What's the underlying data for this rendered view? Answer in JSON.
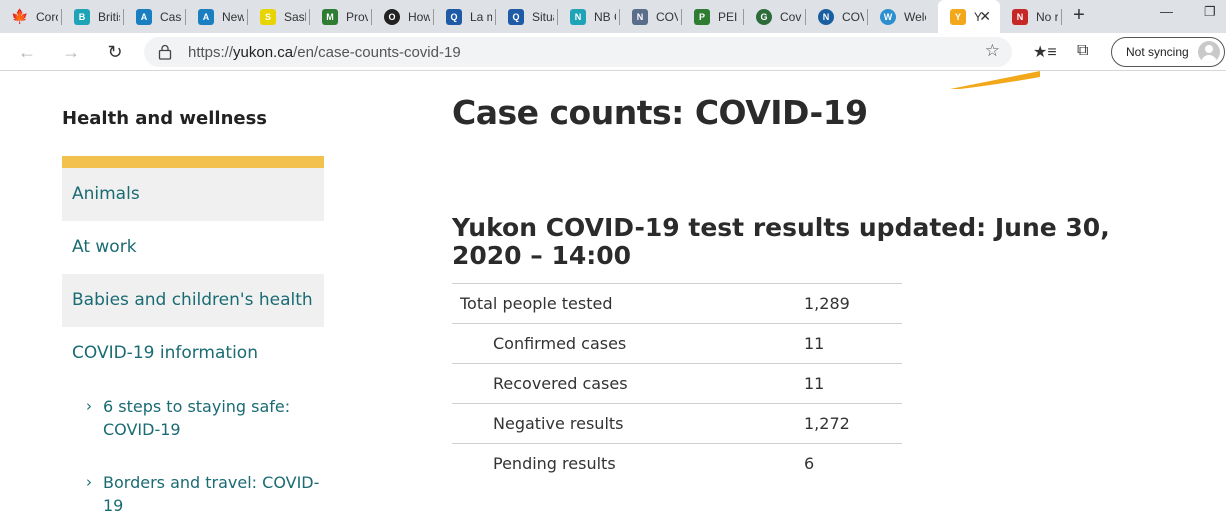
{
  "browser": {
    "tabs": [
      {
        "label": "Coro",
        "icon": "maple-leaf-icon",
        "color": "#d52b1e"
      },
      {
        "label": "Britis",
        "icon": "bc-gov-icon",
        "color": "#1fa3b7"
      },
      {
        "label": "Case",
        "icon": "alberta-icon",
        "color": "#1a7fc1"
      },
      {
        "label": "New",
        "icon": "alberta-icon",
        "color": "#1a7fc1"
      },
      {
        "label": "Sask",
        "icon": "saskatchewan-icon",
        "color": "#d6c400"
      },
      {
        "label": "Prov",
        "icon": "manitoba-icon",
        "color": "#2e7d32"
      },
      {
        "label": "How",
        "icon": "ontario-icon",
        "color": "#222222"
      },
      {
        "label": "La m",
        "icon": "quebec-icon",
        "color": "#1f5aa6"
      },
      {
        "label": "Situa",
        "icon": "quebec-icon",
        "color": "#1f5aa6"
      },
      {
        "label": "NB C",
        "icon": "nb-gov-icon",
        "color": "#1fa3b7"
      },
      {
        "label": "COV",
        "icon": "nova-scotia-icon",
        "color": "#5a6e8c"
      },
      {
        "label": "PEI C",
        "icon": "pei-icon",
        "color": "#2e7d32"
      },
      {
        "label": "Covi",
        "icon": "globe-icon",
        "color": "#2e6b3a"
      },
      {
        "label": "COV",
        "icon": "newfoundland-icon",
        "color": "#1a5fa0"
      },
      {
        "label": "Welc",
        "icon": "nwt-icon",
        "color": "#2c8fd0"
      },
      {
        "label": "Y",
        "icon": "yukon-icon",
        "color": "#f3a81b",
        "active": true
      },
      {
        "label": "No r",
        "icon": "nunavut-icon",
        "color": "#c62828"
      }
    ],
    "url_prefix": "https://",
    "url_domain": "yukon.ca",
    "url_path": "/en/case-counts-covid-19",
    "sync_label": "Not syncing"
  },
  "sidebar": {
    "title": "Health and wellness",
    "items": [
      {
        "label": "Animals"
      },
      {
        "label": "At work"
      },
      {
        "label": "Babies and children's health"
      },
      {
        "label": "COVID-19 information"
      }
    ],
    "subitems": [
      {
        "line1": "6 steps to staying safe:",
        "line2": "COVID-19"
      },
      {
        "line1": "Borders and travel: COVID-",
        "line2": "19"
      }
    ]
  },
  "main": {
    "title": "Case counts: COVID-19",
    "section_title": "Yukon COVID-19 test results updated: June 30, 2020 – 14:00",
    "results": [
      {
        "label": "Total people tested",
        "value": "1,289"
      },
      {
        "label": "Confirmed cases",
        "value": "11"
      },
      {
        "label": "Recovered cases",
        "value": "11"
      },
      {
        "label": "Negative results",
        "value": "1,272"
      },
      {
        "label": "Pending results",
        "value": "6"
      }
    ]
  }
}
